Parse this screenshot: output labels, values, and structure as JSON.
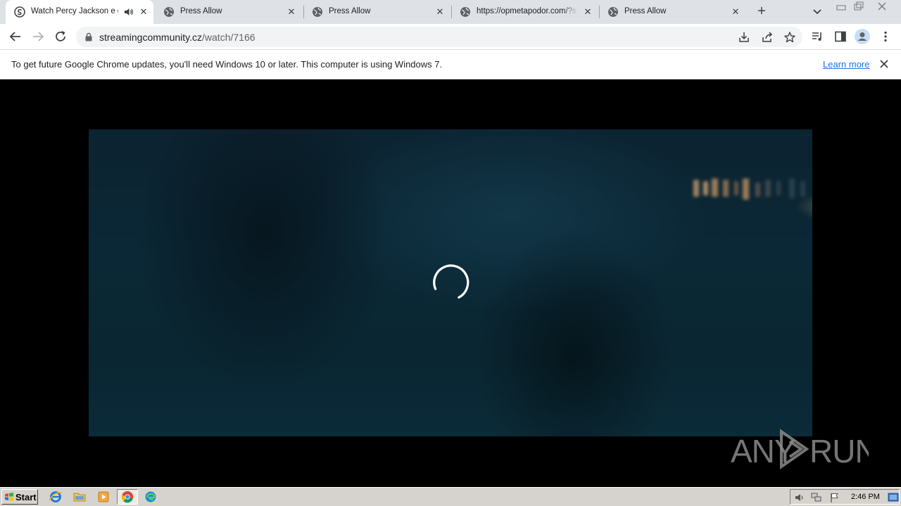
{
  "browser": {
    "tabs": [
      {
        "title": "Watch Percy Jackson e gli",
        "active": true,
        "audio": true
      },
      {
        "title": "Press Allow",
        "active": false
      },
      {
        "title": "Press Allow",
        "active": false
      },
      {
        "title": "https://opmetapodor.com/?s=",
        "active": false
      },
      {
        "title": "Press Allow",
        "active": false
      }
    ],
    "address": {
      "domain": "streamingcommunity.cz",
      "path": "/watch/7166"
    },
    "infobar": {
      "message": "To get future Google Chrome updates, you'll need Windows 10 or later. This computer is using Windows 7.",
      "link": "Learn more"
    }
  },
  "player": {
    "state": "loading"
  },
  "watermark": {
    "text": "ANY RUN"
  },
  "taskbar": {
    "start_label": "Start",
    "clock": "2:46 PM",
    "apps": [
      "internet-explorer-icon",
      "folder-icon",
      "media-player-icon",
      "chrome-icon",
      "edge-icon"
    ]
  },
  "colors": {
    "tabstrip": "#dee1e6",
    "link": "#1a73e8",
    "video_tint": "#0b2836"
  }
}
